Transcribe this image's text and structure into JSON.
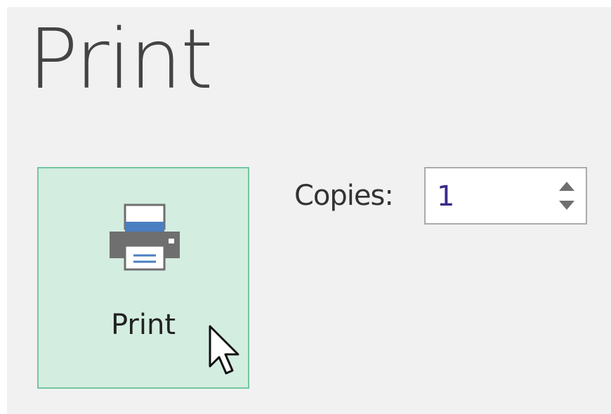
{
  "page": {
    "title": "Print"
  },
  "print_button": {
    "label": "Print",
    "icon": "printer-icon"
  },
  "copies": {
    "label": "Copies:",
    "value": "1",
    "increment_icon": "chevron-up-icon",
    "decrement_icon": "chevron-down-icon"
  },
  "cursor": {
    "icon": "mouse-pointer-icon"
  },
  "colors": {
    "panel_background": "#f1f1f1",
    "button_background": "#d4ede1",
    "button_border": "#73c6a0",
    "printer_gray": "#6f6f6f",
    "printer_blue": "#4a7fc1"
  }
}
